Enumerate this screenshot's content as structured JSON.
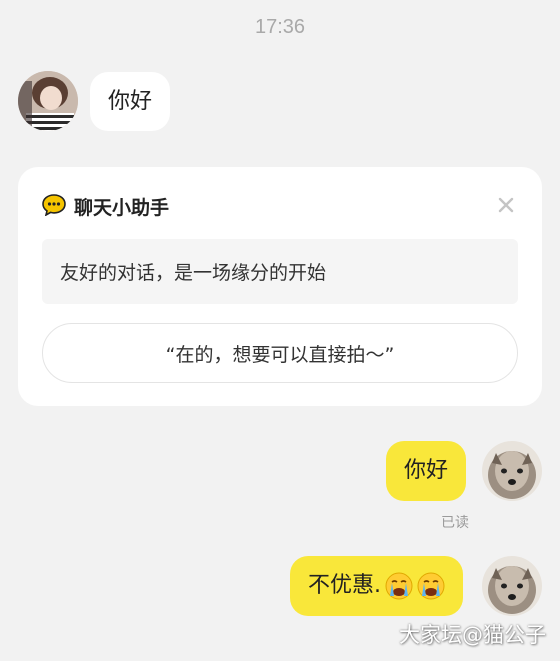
{
  "header": {
    "time": "17:36"
  },
  "messages": [
    {
      "direction": "incoming",
      "text": "你好"
    },
    {
      "direction": "outgoing",
      "text": "你好",
      "status": "已读"
    },
    {
      "direction": "outgoing",
      "text": "不优惠.",
      "emoji": [
        "loudly-crying-face",
        "loudly-crying-face"
      ]
    }
  ],
  "assistant_card": {
    "icon": "chat-bubble-icon",
    "title": "聊天小助手",
    "intro_text": "友好的对话，是一场缘分的开始",
    "suggestion": "“在的，想要可以直接拍～”"
  },
  "watermark": "大家坛@猫公子",
  "colors": {
    "background": "#f2f2f2",
    "outgoing_bubble": "#f9e73a",
    "incoming_bubble": "#ffffff",
    "accent_icon": "#f5c400"
  }
}
